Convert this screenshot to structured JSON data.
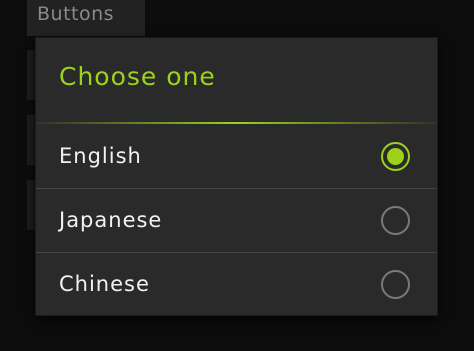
{
  "background": {
    "header_label": "Buttons"
  },
  "dialog": {
    "title": "Choose one",
    "options": [
      {
        "label": "English",
        "selected": true
      },
      {
        "label": "Japanese",
        "selected": false
      },
      {
        "label": "Chinese",
        "selected": false
      }
    ]
  },
  "colors": {
    "accent": "#9cd21c",
    "dialog_background": "#2a2a2a",
    "page_background": "#0c0c0c",
    "option_text": "#f2f2f2",
    "radio_off": "#7a7a7a"
  }
}
